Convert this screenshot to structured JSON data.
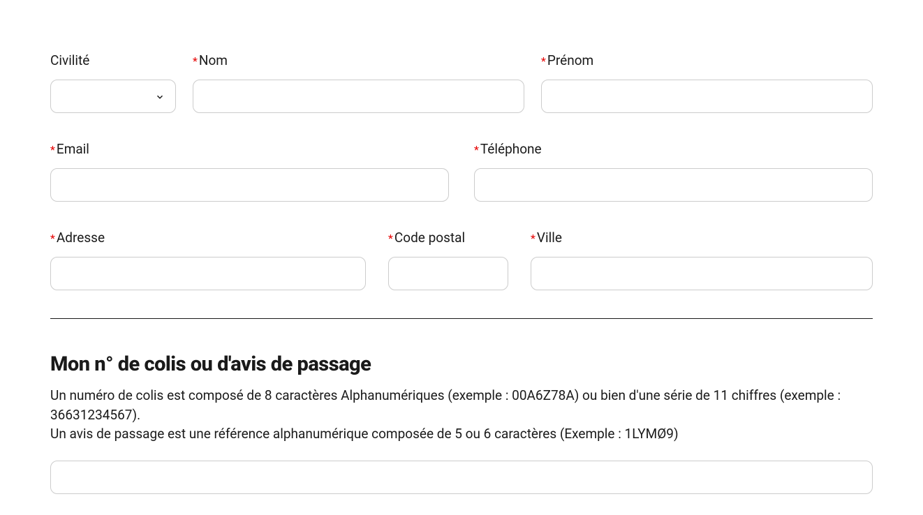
{
  "form": {
    "civilite": {
      "label": "Civilité",
      "required": false
    },
    "nom": {
      "label": "Nom",
      "required": true
    },
    "prenom": {
      "label": "Prénom",
      "required": true
    },
    "email": {
      "label": "Email",
      "required": true
    },
    "telephone": {
      "label": "Téléphone",
      "required": true
    },
    "adresse": {
      "label": "Adresse",
      "required": true
    },
    "codepostal": {
      "label": "Code postal",
      "required": true
    },
    "ville": {
      "label": "Ville",
      "required": true
    }
  },
  "section": {
    "title": "Mon n° de colis ou d'avis de passage",
    "description_line1": "Un numéro de colis est composé de 8 caractères Alphanumériques (exemple : 00A6Z78A) ou bien d'une série de 11 chiffres (exemple : 36631234567).",
    "description_line2": "Un avis de passage est une référence alphanumérique composée de 5 ou 6 caractères (Exemple : 1LYMØ9)"
  },
  "required_marker": "*"
}
